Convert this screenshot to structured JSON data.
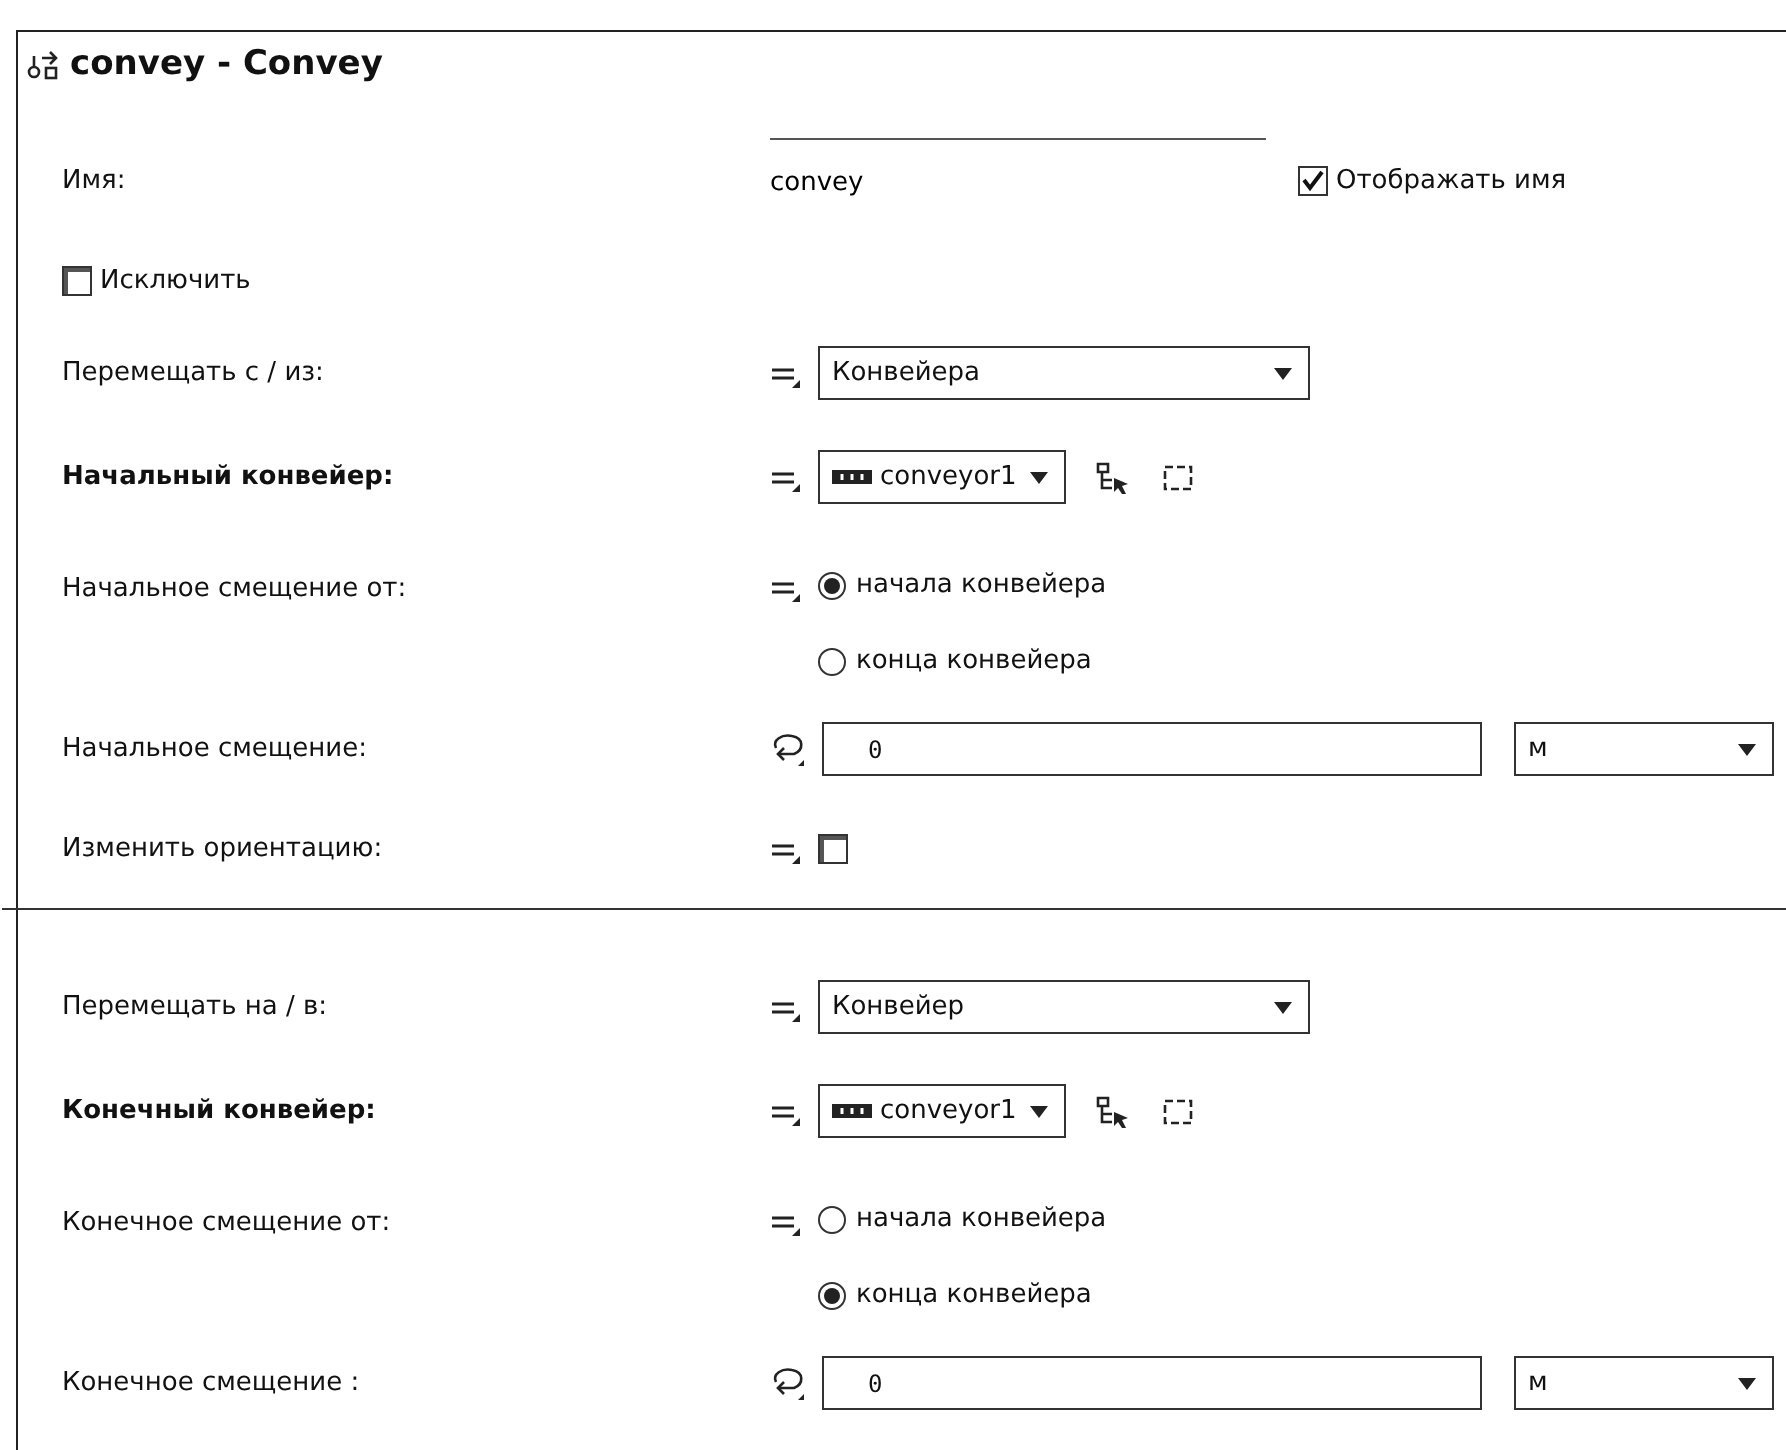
{
  "title": "convey - Convey",
  "fields": [
    {
      "kind": "name",
      "label": "Имя:",
      "value": "convey",
      "option": {
        "label": "Отображать имя",
        "checked": true
      }
    },
    {
      "kind": "checkbox",
      "label": "Исключить",
      "checked": false
    },
    {
      "kind": "dropdown",
      "label": "Перемещать с / из:",
      "bold": false,
      "code_mode": false,
      "value": "Конвейера"
    },
    {
      "kind": "object",
      "label": "Начальный конвейер:",
      "bold": true,
      "code_mode": false,
      "value": "conveyor1"
    },
    {
      "kind": "radio",
      "label": "Начальное смещение от:",
      "bold": false,
      "code_mode": false,
      "options": [
        {
          "label": "начала конвейера",
          "selected": true
        },
        {
          "label": "конца конвейера",
          "selected": false
        }
      ]
    },
    {
      "kind": "value",
      "label": "Начальное смещение:",
      "bold": false,
      "code_mode": true,
      "value": "0",
      "unit": "м"
    },
    {
      "kind": "toggle",
      "label": "Изменить ориентацию:",
      "bold": false,
      "code_mode": false,
      "checked": false
    },
    {
      "kind": "divider"
    },
    {
      "kind": "dropdown",
      "label": "Перемещать на / в:",
      "bold": false,
      "code_mode": false,
      "value": "Конвейер"
    },
    {
      "kind": "object",
      "label": "Конечный конвейер:",
      "bold": true,
      "code_mode": false,
      "value": "conveyor1"
    },
    {
      "kind": "radio",
      "label": "Конечное смещение от:",
      "bold": false,
      "code_mode": false,
      "options": [
        {
          "label": "начала конвейера",
          "selected": false
        },
        {
          "label": "конца конвейера",
          "selected": true
        }
      ]
    },
    {
      "kind": "value",
      "label": "Конечное смещение :",
      "bold": false,
      "code_mode": true,
      "value": "0",
      "unit": "м"
    }
  ]
}
